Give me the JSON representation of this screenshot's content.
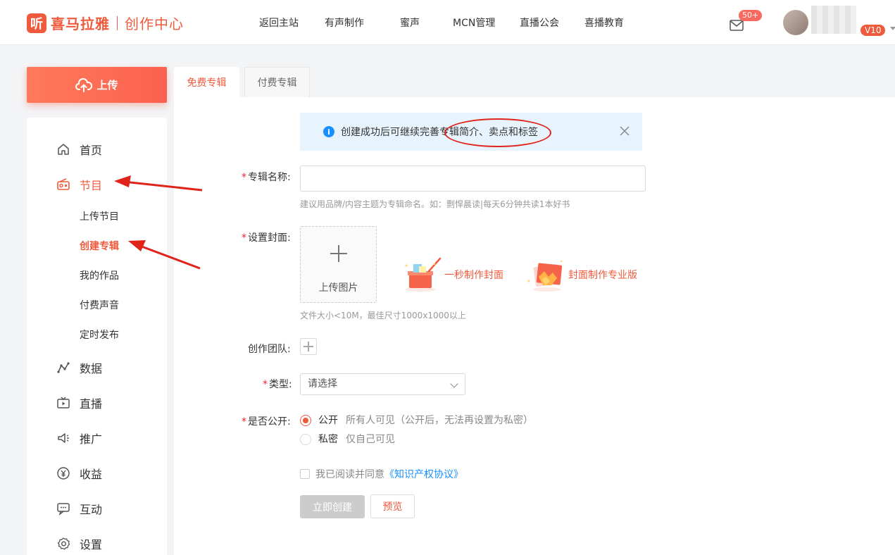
{
  "header": {
    "logo_mark": "听",
    "logo_text": "喜马拉雅",
    "logo_sub": "创作中心",
    "nav": [
      "返回主站",
      "有声制作",
      "蜜声",
      "MCN管理",
      "直播公会",
      "喜播教育"
    ],
    "mail_badge": "50+",
    "vip_badge": "V10"
  },
  "sidebar": {
    "upload_label": "上传",
    "items": [
      {
        "label": "首页",
        "icon": "home-icon"
      },
      {
        "label": "节目",
        "icon": "radio-icon"
      },
      {
        "label": "数据",
        "icon": "chart-icon"
      },
      {
        "label": "直播",
        "icon": "tv-icon"
      },
      {
        "label": "推广",
        "icon": "speaker-icon"
      },
      {
        "label": "收益",
        "icon": "yen-icon"
      },
      {
        "label": "互动",
        "icon": "chat-icon"
      },
      {
        "label": "设置",
        "icon": "gear-icon"
      }
    ],
    "sub_items": [
      "上传节目",
      "创建专辑",
      "我的作品",
      "付费声音",
      "定时发布"
    ]
  },
  "tabs": [
    "免费专辑",
    "付费专辑"
  ],
  "notice": {
    "text": "创建成功后可继续完善专辑简介、卖点和标签"
  },
  "form": {
    "album_name_label": "专辑名称:",
    "album_name_value": "",
    "album_name_hint": "建议用品牌/内容主题为专辑命名。如：剽悍晨读|每天6分钟共读1本好书",
    "cover_label": "设置封面:",
    "upload_image_label": "上传图片",
    "tool_quick": "一秒制作封面",
    "tool_pro": "封面制作专业版",
    "cover_hint": "文件大小<10M，最佳尺寸1000x1000以上",
    "team_label": "创作团队:",
    "type_label": "类型:",
    "type_placeholder": "请选择",
    "public_label": "是否公开:",
    "public_option": "公开",
    "public_desc": "所有人可见（公开后，无法再设置为私密）",
    "private_option": "私密",
    "private_desc": "仅自己可见",
    "agree_text": "我已阅读并同意",
    "agree_link": "《知识产权协议》",
    "create_button": "立即创建",
    "preview_button": "预览"
  },
  "colors": {
    "brand": "#f05a3c",
    "link": "#1890ff",
    "annotation": "#e0231b"
  }
}
